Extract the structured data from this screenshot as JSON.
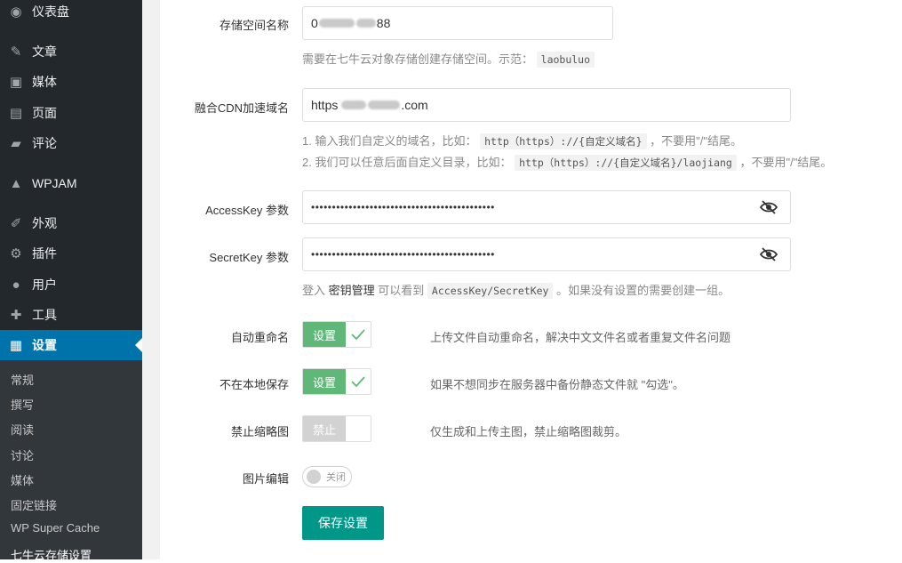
{
  "sidebar": {
    "items": [
      {
        "label": "仪表盘",
        "icon": "dashboard-icon",
        "glyph": "◉"
      },
      {
        "label": "文章",
        "icon": "pin-icon",
        "glyph": "✎"
      },
      {
        "label": "媒体",
        "icon": "media-icon",
        "glyph": "▣"
      },
      {
        "label": "页面",
        "icon": "page-icon",
        "glyph": "▤"
      },
      {
        "label": "评论",
        "icon": "comment-icon",
        "glyph": "▰"
      },
      {
        "label": "WPJAM",
        "icon": "rocket-icon",
        "glyph": "▲"
      },
      {
        "label": "外观",
        "icon": "brush-icon",
        "glyph": "✐"
      },
      {
        "label": "插件",
        "icon": "plugin-icon",
        "glyph": "⚙"
      },
      {
        "label": "用户",
        "icon": "user-icon",
        "glyph": "●"
      },
      {
        "label": "工具",
        "icon": "wrench-icon",
        "glyph": "✚"
      },
      {
        "label": "设置",
        "icon": "settings-icon",
        "glyph": "▦"
      }
    ],
    "submenu": [
      "常规",
      "撰写",
      "阅读",
      "讨论",
      "媒体",
      "固定链接",
      "WP Super Cache",
      "七牛云存储设置"
    ]
  },
  "form": {
    "bucket": {
      "label": "存储空间名称",
      "value_prefix": "0",
      "value_suffix": "88",
      "hint_text": "需要在七牛云对象存储创建存储空间。示范：",
      "hint_code": "laobuluo"
    },
    "cdn": {
      "label": "融合CDN加速域名",
      "value_prefix": "https",
      "value_suffix": ".com",
      "hint1_text": "1. 输入我们自定义的域名，比如：",
      "hint1_code": "http（https）://{自定义域名}",
      "hint1_tail": "，不要用\"/\"结尾。",
      "hint2_text": "2. 我们可以任意后面自定义目录，比如：",
      "hint2_code": "http（https）://{自定义域名}/laojiang",
      "hint2_tail": "，不要用\"/\"结尾。"
    },
    "accesskey": {
      "label": "AccessKey 参数",
      "value": "••••••••••••••••••••••••••••••••••••••••••••"
    },
    "secretkey": {
      "label": "SecretKey 参数",
      "value": "••••••••••••••••••••••••••••••••••••••••••••"
    },
    "key_hint": {
      "pre": "登入",
      "link": "密钥管理",
      "mid": "可以看到",
      "code": "AccessKey/SecretKey",
      "tail": "。如果没有设置的需要创建一组。"
    },
    "auto_rename": {
      "label": "自动重命名",
      "switch_label": "设置",
      "checked": true,
      "desc": "上传文件自动重命名，解决中文文件名或者重复文件名问题"
    },
    "no_local": {
      "label": "不在本地保存",
      "switch_label": "设置",
      "checked": true,
      "desc": "如果不想同步在服务器中备份静态文件就 \"勾选\"。"
    },
    "no_thumb": {
      "label": "禁止缩略图",
      "switch_label": "禁止",
      "checked": false,
      "desc": "仅生成和上传主图，禁止缩略图裁剪。"
    },
    "image_edit": {
      "label": "图片编辑",
      "toggle_label": "关闭",
      "on": false
    },
    "save_label": "保存设置"
  },
  "colors": {
    "sidebar_bg": "#23282d",
    "active": "#0073aa",
    "switch_on": "#5fb878",
    "save_button": "#009688"
  }
}
